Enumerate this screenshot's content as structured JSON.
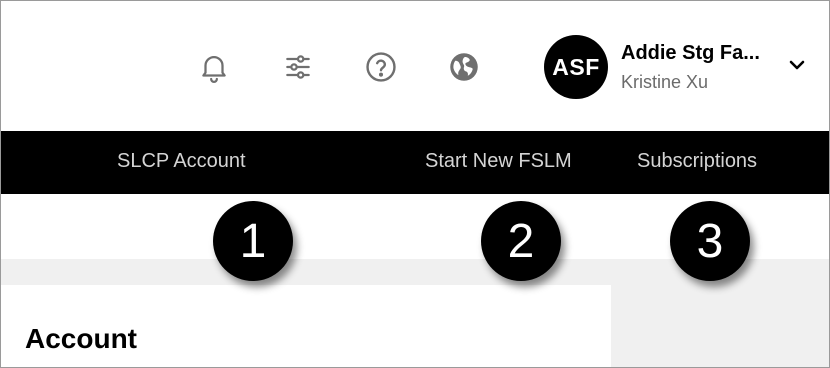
{
  "header": {
    "icons": [
      {
        "name": "bell-icon",
        "label": ""
      },
      {
        "name": "sliders-icon",
        "label": ""
      },
      {
        "name": "help-icon",
        "label": ""
      },
      {
        "name": "globe-icon",
        "label": ""
      }
    ],
    "user": {
      "initials": "ASF",
      "name": "Addie Stg Fa...",
      "subtitle": "Kristine Xu"
    }
  },
  "nav": {
    "items": [
      "SLCP Account",
      "Start New FSLM",
      "Subscriptions"
    ]
  },
  "callouts": [
    "1",
    "2",
    "3"
  ],
  "content": {
    "card_title": "Account"
  },
  "colors": {
    "nav_bg": "#000000",
    "nav_text": "#d4d4d4",
    "icon_gray": "#6f6f6f",
    "band_bg": "#f0f0f0"
  }
}
